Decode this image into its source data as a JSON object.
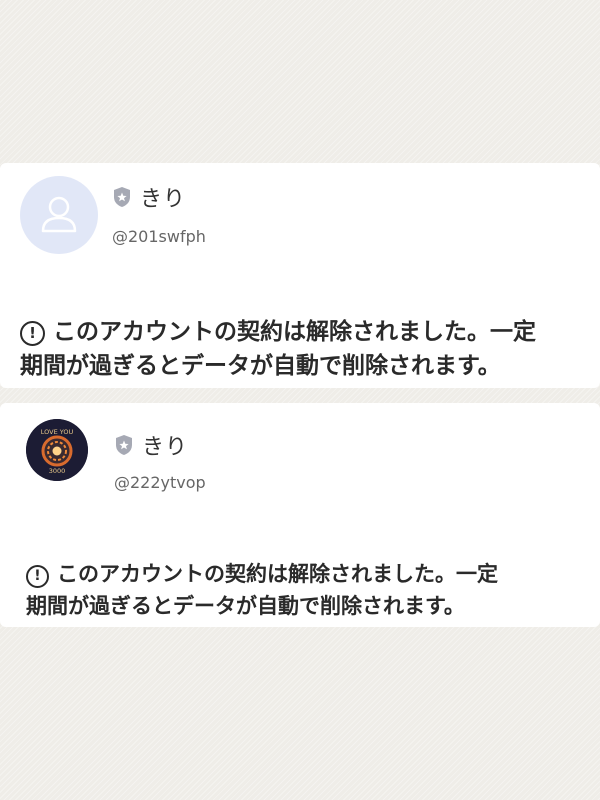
{
  "accounts": [
    {
      "name": "きり",
      "handle": "@201swfph",
      "avatar": "default-person-icon",
      "notice_line1": "このアカウントの契約は解除されました。一定",
      "notice_line2": "期間が過ぎるとデータが自動で削除されます。"
    },
    {
      "name": "きり",
      "handle": "@222ytvop",
      "avatar": "love-you-3000-logo",
      "avatar_text_top": "LOVE YOU",
      "avatar_text_bottom": "3000",
      "notice_line1": "このアカウントの契約は解除されました。一定",
      "notice_line2": "期間が過ぎるとデータが自動で削除されます。"
    }
  ],
  "alert_glyph": "!",
  "colors": {
    "background": "#efede8",
    "card": "#ffffff",
    "default_avatar_bg": "#e1e7f7",
    "shield_badge": "#a6a9b4"
  }
}
